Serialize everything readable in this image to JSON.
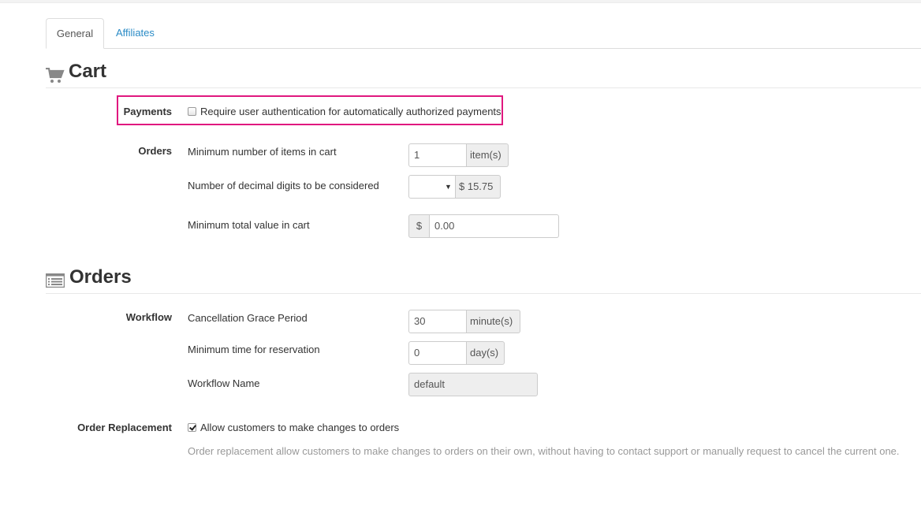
{
  "tabs": [
    {
      "label": "General",
      "active": true
    },
    {
      "label": "Affiliates",
      "active": false
    }
  ],
  "cart": {
    "title": "Cart",
    "icon": "cart-icon",
    "payments": {
      "label": "Payments",
      "checkbox_label": "Require user authentication for automatically authorized payments",
      "checked": false
    },
    "orders": {
      "label": "Orders",
      "min_items": {
        "label": "Minimum number of items in cart",
        "value": "1",
        "unit": "item(s)"
      },
      "decimal_digits": {
        "label": "Number of decimal digits to be considered",
        "selected": "",
        "preview": "$ 15.75"
      },
      "min_total": {
        "label": "Minimum total value in cart",
        "currency": "$",
        "value": "0.00"
      }
    }
  },
  "orders_section": {
    "title": "Orders",
    "icon": "list-icon",
    "workflow": {
      "label": "Workflow",
      "grace": {
        "label": "Cancellation Grace Period",
        "value": "30",
        "unit": "minute(s)"
      },
      "reservation": {
        "label": "Minimum time for reservation",
        "value": "0",
        "unit": "day(s)"
      },
      "name": {
        "label": "Workflow Name",
        "value": "default"
      }
    },
    "replacement": {
      "label": "Order Replacement",
      "checkbox_label": "Allow customers to make changes to orders",
      "checked": true,
      "help": "Order replacement allow customers to make changes to orders on their own, without having to contact support or manually request to cancel the current one."
    }
  },
  "colors": {
    "highlight": "#e0187f",
    "link": "#2a8bc6"
  }
}
